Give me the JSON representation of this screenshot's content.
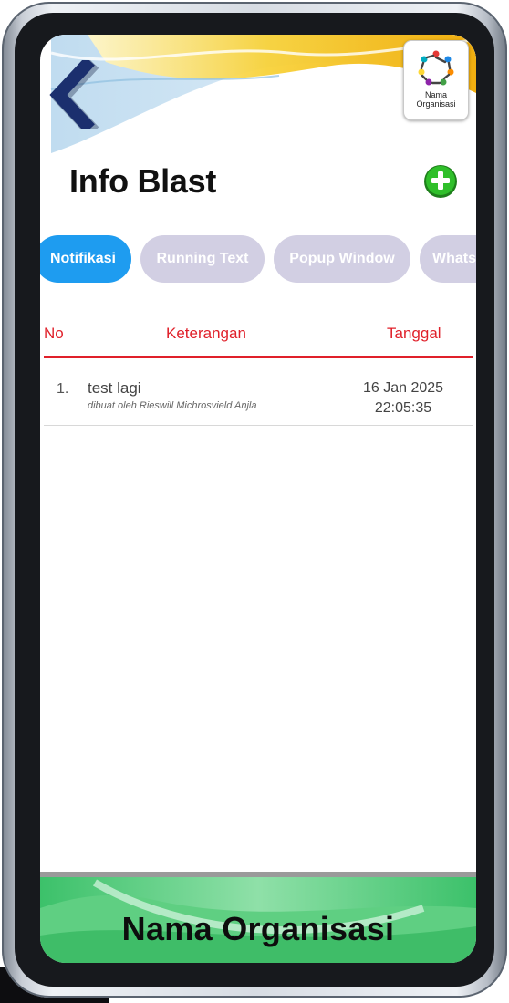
{
  "header": {
    "logo_line1": "Nama",
    "logo_line2": "Organisasi",
    "title": "Info Blast"
  },
  "tabs": [
    {
      "label": "Notifikasi",
      "active": true
    },
    {
      "label": "Running Text",
      "active": false
    },
    {
      "label": "Popup Window",
      "active": false
    },
    {
      "label": "Whatsapp",
      "active": false
    }
  ],
  "table": {
    "columns": {
      "no": "No",
      "description": "Keterangan",
      "date": "Tanggal"
    },
    "rows": [
      {
        "no": "1.",
        "title": "test lagi",
        "subtitle": "dibuat oleh Rieswill Michrosvield Anjla",
        "date": "16 Jan 2025",
        "time": "22:05:35"
      }
    ]
  },
  "footer": {
    "title": "Nama Organisasi"
  },
  "colors": {
    "accent_red": "#e0202a",
    "tab_active": "#1e9cf0",
    "tab_inactive": "#d2cfe3",
    "add_green": "#27b024",
    "back_navy": "#1b2f6e"
  },
  "icons": {
    "back": "chevron-left-icon",
    "add": "plus-circle-icon",
    "logo": "people-circle-logo-icon"
  }
}
